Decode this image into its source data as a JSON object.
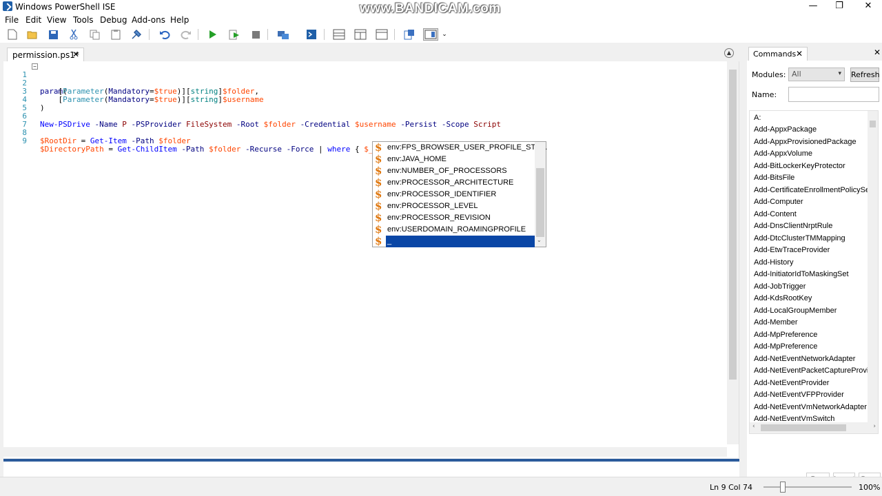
{
  "window": {
    "title": "Windows PowerShell ISE",
    "watermark": "www.BANDICAM.com",
    "minimize": "—",
    "maximize": "❐",
    "close": "✕"
  },
  "menu": [
    "File",
    "Edit",
    "View",
    "Tools",
    "Debug",
    "Add-ons",
    "Help"
  ],
  "toolbar_icons": [
    "new-icon",
    "open-icon",
    "save-icon",
    "cut-icon",
    "copy-icon",
    "paste-icon",
    "clear-icon",
    "undo-icon",
    "redo-icon",
    "run-icon",
    "run-selection-icon",
    "stop-icon",
    "remote-icon",
    "console-icon",
    "script-pane-top-icon",
    "script-pane-right-icon",
    "script-pane-max-icon",
    "show-commands-icon",
    "addon-toggle-icon"
  ],
  "tab": {
    "label": "permission.ps1*",
    "close": "✕"
  },
  "editor": {
    "line_numbers": [
      "1",
      "2",
      "3",
      "4",
      "5",
      "6",
      "7",
      "8",
      "9"
    ]
  },
  "intellisense": {
    "items": [
      "env:FPS_BROWSER_USER_PROFILE_STR...",
      "env:JAVA_HOME",
      "env:NUMBER_OF_PROCESSORS",
      "env:PROCESSOR_ARCHITECTURE",
      "env:PROCESSOR_IDENTIFIER",
      "env:PROCESSOR_LEVEL",
      "env:PROCESSOR_REVISION",
      "env:USERDOMAIN_ROAMINGPROFILE",
      "_"
    ],
    "icon_glyph": "$"
  },
  "commands": {
    "tab_label": "Commands",
    "modules_label": "Modules:",
    "modules_value": "All",
    "refresh_label": "Refresh",
    "name_label": "Name:",
    "items": [
      "A:",
      "Add-AppxPackage",
      "Add-AppxProvisionedPackage",
      "Add-AppxVolume",
      "Add-BitLockerKeyProtector",
      "Add-BitsFile",
      "Add-CertificateEnrollmentPolicyServ",
      "Add-Computer",
      "Add-Content",
      "Add-DnsClientNrptRule",
      "Add-DtcClusterTMMapping",
      "Add-EtwTraceProvider",
      "Add-History",
      "Add-InitiatorIdToMaskingSet",
      "Add-JobTrigger",
      "Add-KdsRootKey",
      "Add-LocalGroupMember",
      "Add-Member",
      "Add-MpPreference",
      "Add-MpPreference",
      "Add-NetEventNetworkAdapter",
      "Add-NetEventPacketCaptureProvide",
      "Add-NetEventProvider",
      "Add-NetEventVFPProvider",
      "Add-NetEventVmNetworkAdapter",
      "Add-NetEventVmSwitch"
    ],
    "run_label": "Run",
    "insert_label": "Insert",
    "copy_label": "Copy"
  },
  "status": {
    "position": "Ln 9  Col 74",
    "zoom": "100%"
  },
  "colors": {
    "variable": "#ff4500",
    "type": "#008080",
    "selection": "#0a46a6",
    "console_divider": "#2a5a9b"
  }
}
